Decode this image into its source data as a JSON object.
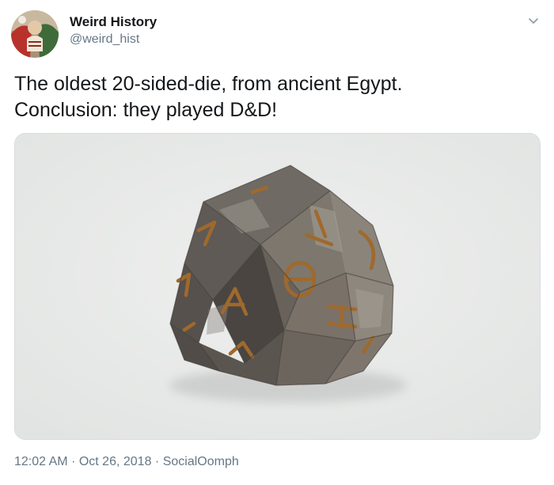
{
  "author": {
    "display_name": "Weird History",
    "handle": "@weird_hist"
  },
  "tweet": {
    "line1": "The oldest 20-sided-die, from ancient Egypt.",
    "line2": "Conclusion: they played D&D!"
  },
  "meta": {
    "time": "12:02 AM",
    "date": "Oct 26, 2018",
    "separator": "·",
    "source": "SocialOomph"
  },
  "icons": {
    "avatar": "avatar",
    "menu": "chevron-down-icon"
  },
  "colors": {
    "text": "#14171a",
    "secondary": "#657786",
    "media_border": "#d9dde1",
    "media_background": "#e9ebeb"
  }
}
